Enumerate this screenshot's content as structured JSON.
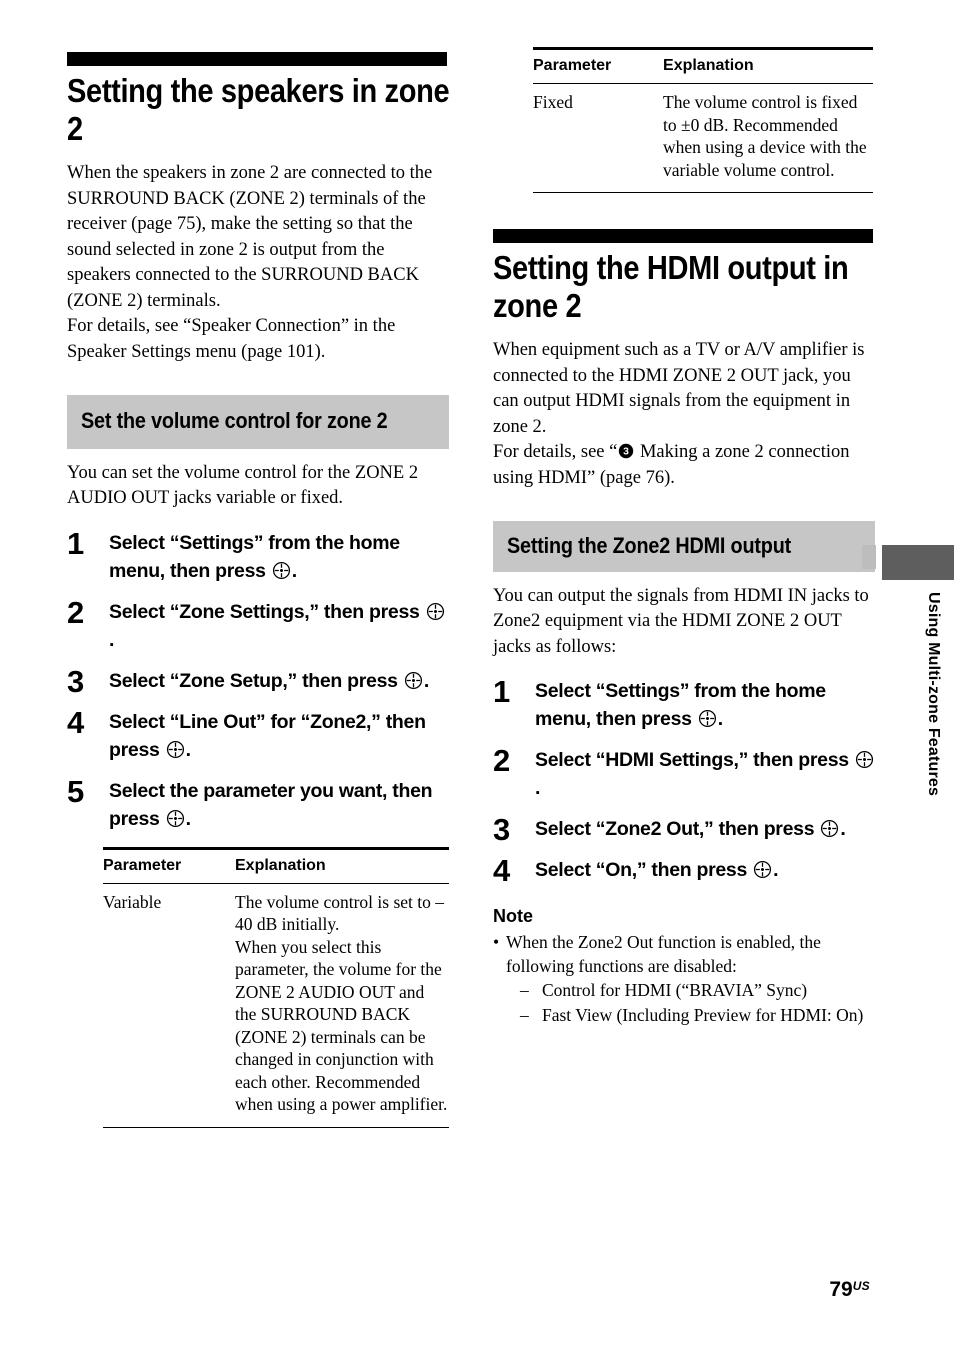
{
  "page": {
    "number": "79",
    "number_suffix": "US"
  },
  "side_tab": {
    "label": "Using Multi-zone Features",
    "block_color": "#5e5e5e",
    "marker_color": "#bdbdbd"
  },
  "icons": {
    "enter_button": "enter-button-icon",
    "circled_three": "③"
  },
  "left_column": {
    "chapter_title": "Setting the speakers in zone 2",
    "intro": "When the speakers in zone 2 are connected to the SURROUND BACK (ZONE 2) terminals of the receiver (page 75), make the setting so that the sound selected in zone 2 is output from the speakers connected to the SURROUND BACK (ZONE 2) terminals.\nFor details, see “Speaker Connection” in the Speaker Settings menu (page 101).",
    "section": {
      "heading": "Set the volume control for zone 2",
      "heading_bg": "#c6c6c6",
      "lead": "You can set the volume control for the ZONE 2 AUDIO OUT jacks variable or fixed.",
      "steps": [
        {
          "num": "1",
          "text_before": "Select “Settings” from the home menu, then press ",
          "icon": "enter-button-icon",
          "text_after": "."
        },
        {
          "num": "2",
          "text_before": "Select “Zone Settings,” then press ",
          "icon": "enter-button-icon",
          "text_after": "."
        },
        {
          "num": "3",
          "text_before": "Select “Zone Setup,” then press ",
          "icon": "enter-button-icon",
          "text_after": "."
        },
        {
          "num": "4",
          "text_before": "Select “Line Out” for “Zone2,” then press ",
          "icon": "enter-button-icon",
          "text_after": "."
        },
        {
          "num": "5",
          "text_before": "Select the parameter you want, then press ",
          "icon": "enter-button-icon",
          "text_after": "."
        }
      ],
      "table": {
        "headers": [
          "Parameter",
          "Explanation"
        ],
        "rows": [
          {
            "parameter": "Variable",
            "explanation": "The volume control is set to –40 dB initially.\nWhen you select this parameter, the volume for the ZONE 2 AUDIO OUT and the SURROUND BACK (ZONE 2) terminals can be changed in conjunction with each other. Recommended when using a power amplifier."
          }
        ]
      }
    }
  },
  "right_column": {
    "continued_table": {
      "headers": [
        "Parameter",
        "Explanation"
      ],
      "rows": [
        {
          "parameter": "Fixed",
          "explanation": "The volume control is fixed to ±0 dB. Recommended when using a device with the variable volume control."
        }
      ]
    },
    "chapter_title": "Setting the HDMI output in zone 2",
    "intro_1": "When equipment such as a TV or A/V amplifier is connected to the HDMI ZONE 2 OUT jack, you can output HDMI signals from the equipment in zone 2.",
    "intro_2_before": "For details, see “",
    "intro_2_icon": "circled-three-icon",
    "intro_2_after": " Making a zone 2 connection using HDMI” (page 76).",
    "section": {
      "heading": "Setting the Zone2 HDMI output",
      "heading_bg": "#c6c6c6",
      "lead": "You can output the signals from HDMI IN jacks to Zone2 equipment via the HDMI ZONE 2 OUT jacks as follows:",
      "steps": [
        {
          "num": "1",
          "text_before": "Select “Settings” from the home menu, then press ",
          "icon": "enter-button-icon",
          "text_after": "."
        },
        {
          "num": "2",
          "text_before": "Select “HDMI Settings,” then press ",
          "icon": "enter-button-icon",
          "text_after": "."
        },
        {
          "num": "3",
          "text_before": "Select “Zone2 Out,” then press ",
          "icon": "enter-button-icon",
          "text_after": "."
        },
        {
          "num": "4",
          "text_before": "Select “On,” then press ",
          "icon": "enter-button-icon",
          "text_after": "."
        }
      ]
    },
    "note": {
      "title": "Note",
      "bullet": "When the Zone2 Out function is enabled, the following functions are disabled:",
      "sub_items": [
        "Control for HDMI (“BRAVIA” Sync)",
        "Fast View (Including Preview for HDMI: On)"
      ]
    }
  }
}
